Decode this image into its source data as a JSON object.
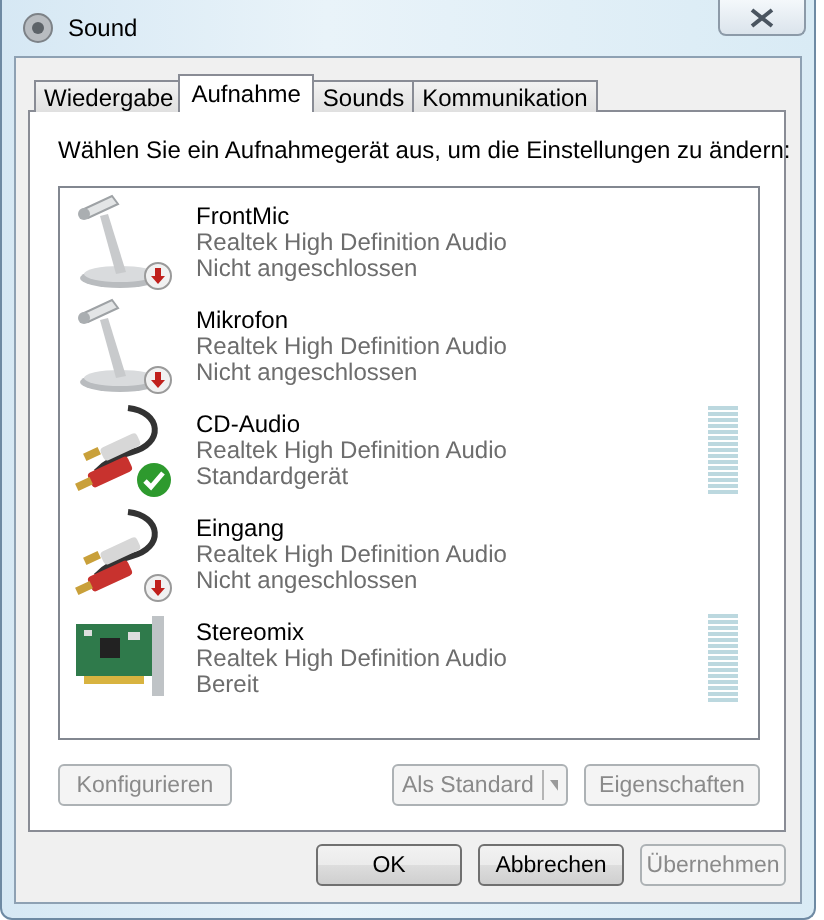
{
  "window": {
    "title": "Sound"
  },
  "tabs": [
    {
      "label": "Wiedergabe",
      "selected": false
    },
    {
      "label": "Aufnahme",
      "selected": true
    },
    {
      "label": "Sounds",
      "selected": false
    },
    {
      "label": "Kommunikation",
      "selected": false
    }
  ],
  "instruction": "Wählen Sie ein Aufnahmegerät aus, um die Einstellungen zu ändern:",
  "devices": [
    {
      "kind": "microphone",
      "unplugged": true,
      "default": false,
      "name": "FrontMic",
      "driver": "Realtek High Definition Audio",
      "status": "Nicht angeschlossen"
    },
    {
      "kind": "microphone",
      "unplugged": true,
      "default": false,
      "name": "Mikrofon",
      "driver": "Realtek High Definition Audio",
      "status": "Nicht angeschlossen"
    },
    {
      "kind": "cable",
      "unplugged": false,
      "default": true,
      "name": "CD-Audio",
      "driver": "Realtek High Definition Audio",
      "status": "Standardgerät",
      "level": 0
    },
    {
      "kind": "cable",
      "unplugged": true,
      "default": false,
      "name": "Eingang",
      "driver": "Realtek High Definition Audio",
      "status": "Nicht angeschlossen"
    },
    {
      "kind": "card",
      "unplugged": false,
      "default": false,
      "name": "Stereomix",
      "driver": "Realtek High Definition Audio",
      "status": "Bereit",
      "level": 0
    }
  ],
  "panel_buttons": [
    {
      "label": "Konfigurieren",
      "kind": "plain",
      "disabled": true
    },
    {
      "label": "Als Standard",
      "kind": "split",
      "disabled": true
    },
    {
      "label": "Eigenschaften",
      "kind": "plain",
      "disabled": true
    }
  ],
  "dialog_buttons": [
    {
      "label": "OK",
      "disabled": false
    },
    {
      "label": "Abbrechen",
      "disabled": false
    },
    {
      "label": "Übernehmen",
      "disabled": true
    }
  ]
}
